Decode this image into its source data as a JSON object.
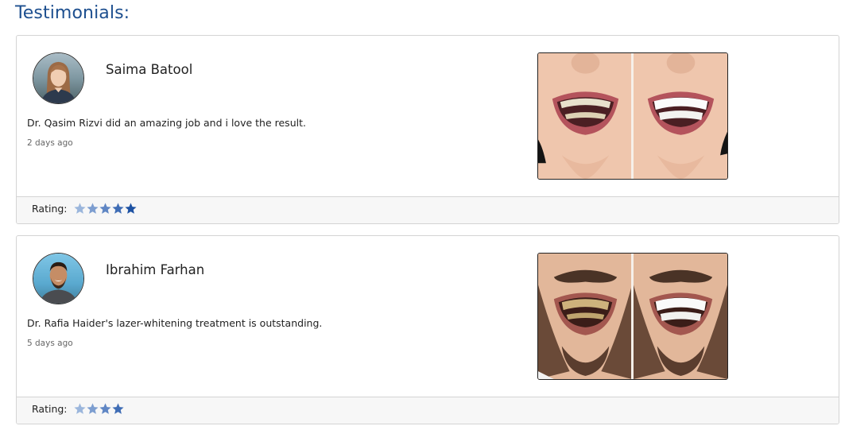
{
  "section": {
    "title": "Testimonials:"
  },
  "testimonials": [
    {
      "name": "Saima Batool",
      "avatar_icon": "user-avatar-woman",
      "text": "Dr. Qasim Rizvi did an amazing job and i love the result.",
      "time": "2 days ago",
      "image": "before-after-smile-woman",
      "rating_label": "Rating:",
      "rating": 5,
      "star_colors": [
        "#9bb6dc",
        "#7d9ed0",
        "#5f86c4",
        "#3f6db5",
        "#1e52a3"
      ]
    },
    {
      "name": "Ibrahim Farhan",
      "avatar_icon": "user-avatar-man",
      "text": "Dr. Rafia Haider's lazer-whitening treatment is outstanding.",
      "time": "5 days ago",
      "image": "before-after-smile-man",
      "rating_label": "Rating:",
      "rating": 4,
      "star_colors": [
        "#9bb6dc",
        "#7d9ed0",
        "#5f86c4",
        "#3f6db5"
      ]
    }
  ],
  "colors": {
    "title": "#1d4f8f",
    "card_border": "#d4d4d4",
    "footer_bg": "#f7f7f7"
  }
}
